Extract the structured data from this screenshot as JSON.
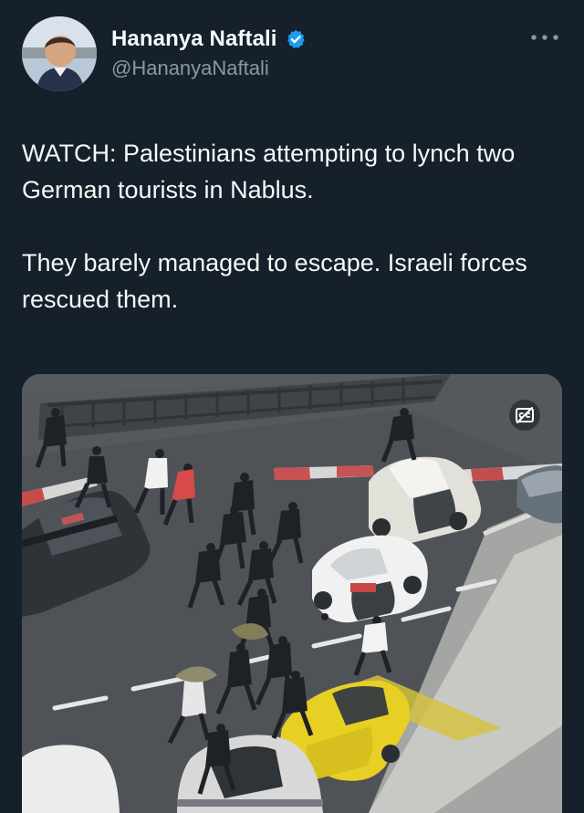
{
  "tweet": {
    "author": {
      "display_name": "Hananya Naftali",
      "handle": "@HananyaNaftali",
      "verified": true
    },
    "text": "WATCH: Palestinians attempting to lynch two German tourists in Nablus.\n\nThey barely managed to escape. Israeli forces rescued them.",
    "media": {
      "type": "video",
      "caption_icon": "closed-captions-off-icon"
    }
  },
  "icons": {
    "verified": "verified-badge-icon",
    "more": "more-options-icon",
    "captions": "closed-captions-off-icon"
  },
  "colors": {
    "background": "#15202b",
    "primary_text": "#f7f9f9",
    "secondary_text": "#8b98a5",
    "verified": "#1d9bf0"
  }
}
